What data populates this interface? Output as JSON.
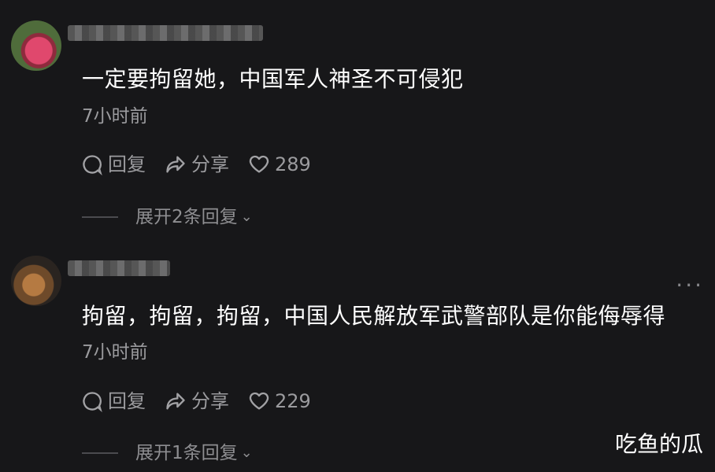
{
  "comments": [
    {
      "text": "一定要拘留她，中国军人神圣不可侵犯",
      "time": "7小时前",
      "reply_label": "回复",
      "share_label": "分享",
      "likes": "289",
      "expand_label": "展开2条回复"
    },
    {
      "text": "拘留，拘留，拘留，中国人民解放军武警部队是你能侮辱得",
      "time": "7小时前",
      "reply_label": "回复",
      "share_label": "分享",
      "likes": "229",
      "expand_label": "展开1条回复"
    }
  ],
  "more_label": "···",
  "watermark": "吃鱼的瓜"
}
